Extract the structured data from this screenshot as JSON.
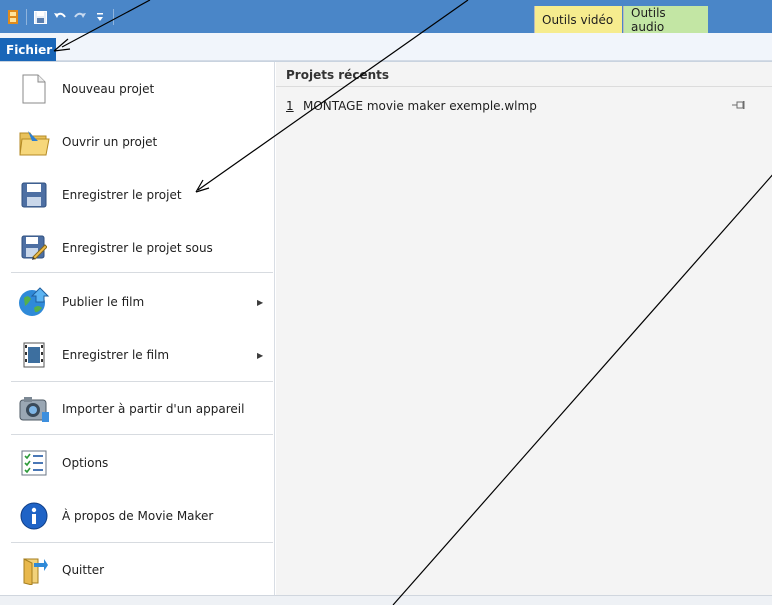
{
  "titlebar": {
    "qat_icons": [
      "app-icon",
      "save-icon",
      "undo-icon",
      "redo-icon",
      "customize-dropdown-icon"
    ],
    "context_tabs": [
      "Outils vidéo",
      "Outils audio"
    ]
  },
  "ribbon": {
    "file_tab": "Fichier"
  },
  "menu": {
    "items": [
      {
        "label": "Nouveau projet",
        "icon": "new-document-icon"
      },
      {
        "label": "Ouvrir un projet",
        "icon": "open-folder-icon"
      },
      {
        "label": "Enregistrer le projet",
        "icon": "save-disk-icon"
      },
      {
        "label": "Enregistrer le projet sous",
        "icon": "save-as-icon"
      },
      {
        "label": "Publier le film",
        "icon": "publish-globe-icon",
        "submenu": true
      },
      {
        "label": "Enregistrer le film",
        "icon": "film-save-icon",
        "submenu": true
      },
      {
        "label": "Importer à partir d'un appareil",
        "icon": "camera-import-icon"
      },
      {
        "label": "Options",
        "icon": "options-checklist-icon"
      },
      {
        "label": "À propos de Movie Maker",
        "icon": "info-icon"
      },
      {
        "label": "Quitter",
        "icon": "exit-icon"
      }
    ]
  },
  "recent": {
    "title": "Projets récents",
    "items": [
      {
        "number": "1",
        "name": "MONTAGE movie maker exemple.wlmp"
      }
    ]
  },
  "colors": {
    "titlebar": "#4a86c8",
    "file_tab": "#1966b8",
    "video_tab": "#f6ec8e",
    "audio_tab": "#c3e6a4"
  }
}
